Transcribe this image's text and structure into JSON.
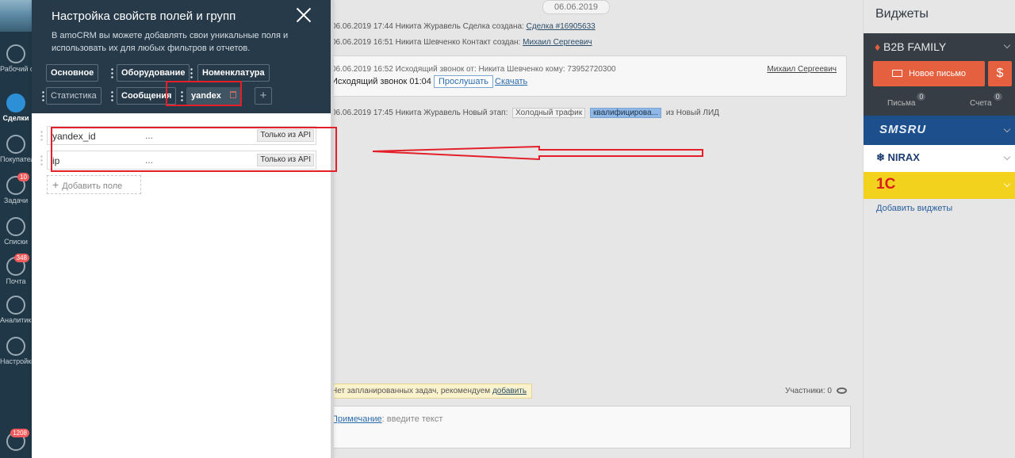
{
  "nav": {
    "items": [
      {
        "label": "Рабочий стол",
        "icon": "gauge-icon",
        "badge": ""
      },
      {
        "label": "Сделки",
        "icon": "deals-icon",
        "badge": "",
        "active": true
      },
      {
        "label": "Покупатели",
        "icon": "customers-icon",
        "badge": ""
      },
      {
        "label": "Задачи",
        "icon": "check-icon",
        "badge": "10"
      },
      {
        "label": "Списки",
        "icon": "list-icon",
        "badge": ""
      },
      {
        "label": "Почта",
        "icon": "mail-icon",
        "badge": "348"
      },
      {
        "label": "Аналитика",
        "icon": "chart-icon",
        "badge": ""
      },
      {
        "label": "Настройки",
        "icon": "wrench-icon",
        "badge": ""
      }
    ],
    "chat_badge": "1208"
  },
  "modal": {
    "title": "Настройка свойств полей и групп",
    "description": "В amoCRM вы можете добавлять свои уникальные поля и использовать их для любых фильтров и отчетов.",
    "tabs": [
      "Основное",
      "Оборудование",
      "Номенклатура",
      "Статистика",
      "Сообщения",
      "yandex"
    ],
    "active_tab": "yandex",
    "fields": [
      {
        "name": "yandex_id",
        "value": "...",
        "badge": "Только из API"
      },
      {
        "name": "ip",
        "value": "...",
        "badge": "Только из API"
      }
    ],
    "add_field_label": "Добавить поле"
  },
  "feed": {
    "date": "06.06.2019",
    "line1": {
      "prefix": "06.06.2019 17:44 Никита Журавель  Сделка создана:",
      "link": "Сделка #16905633"
    },
    "line2": {
      "prefix": "06.06.2019 16:51 Никита Шевченко  Контакт создан:",
      "link": "Михаил Сергеевич"
    },
    "call": {
      "meta": "06.06.2019 16:52 Исходящий звонок от: Никита Шевченко кому: 73952720300",
      "user": "Михаил Сергеевич",
      "title": "Исходящий звонок 01:04",
      "listen": "Прослушать",
      "download": "Скачать"
    },
    "stage": {
      "prefix": "06.06.2019 17:45 Никита Журавель  Новый этап:",
      "tag1": "Холодный трафик",
      "tag2": "квалифицирова...",
      "suffix": "из Новый ЛИД"
    },
    "notice": {
      "text": "Нет запланированных задач, рекомендуем",
      "link": "добавить"
    },
    "participants": "Участники: 0",
    "composer": {
      "link": "Примечание",
      "text": ": введите текст"
    }
  },
  "widgets": {
    "title": "Виджеты",
    "b2b": {
      "name": "B2B FAMILY",
      "mail_button": "Новое письмо",
      "dollar": "$",
      "letters_label": "Письма",
      "letters_count": "0",
      "invoices_label": "Счета",
      "invoices_count": "0"
    },
    "sms": "SMSRU",
    "nirax": "NIRAX",
    "onec": "1С",
    "add": "Добавить виджеты"
  },
  "colors": {
    "accent": "#e5603e",
    "header": "#263a4a",
    "highlight": "#e3202a"
  }
}
